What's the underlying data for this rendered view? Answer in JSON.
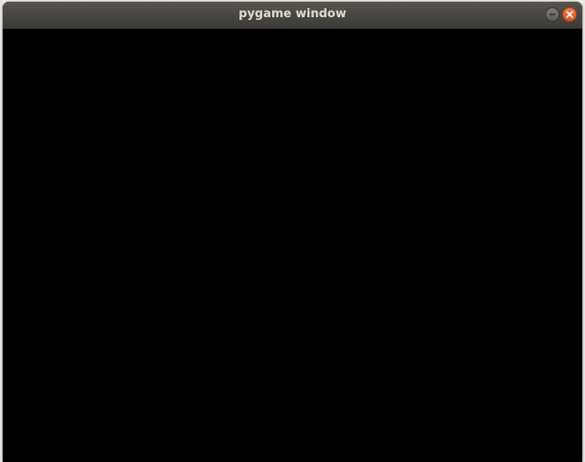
{
  "window": {
    "title": "pygame window"
  },
  "titlebar": {
    "buttons": [
      {
        "name": "minimize",
        "icon": "minimize-icon"
      },
      {
        "name": "close",
        "icon": "close-icon",
        "color": "#e95420"
      }
    ]
  },
  "canvas": {
    "background": "#000000"
  }
}
